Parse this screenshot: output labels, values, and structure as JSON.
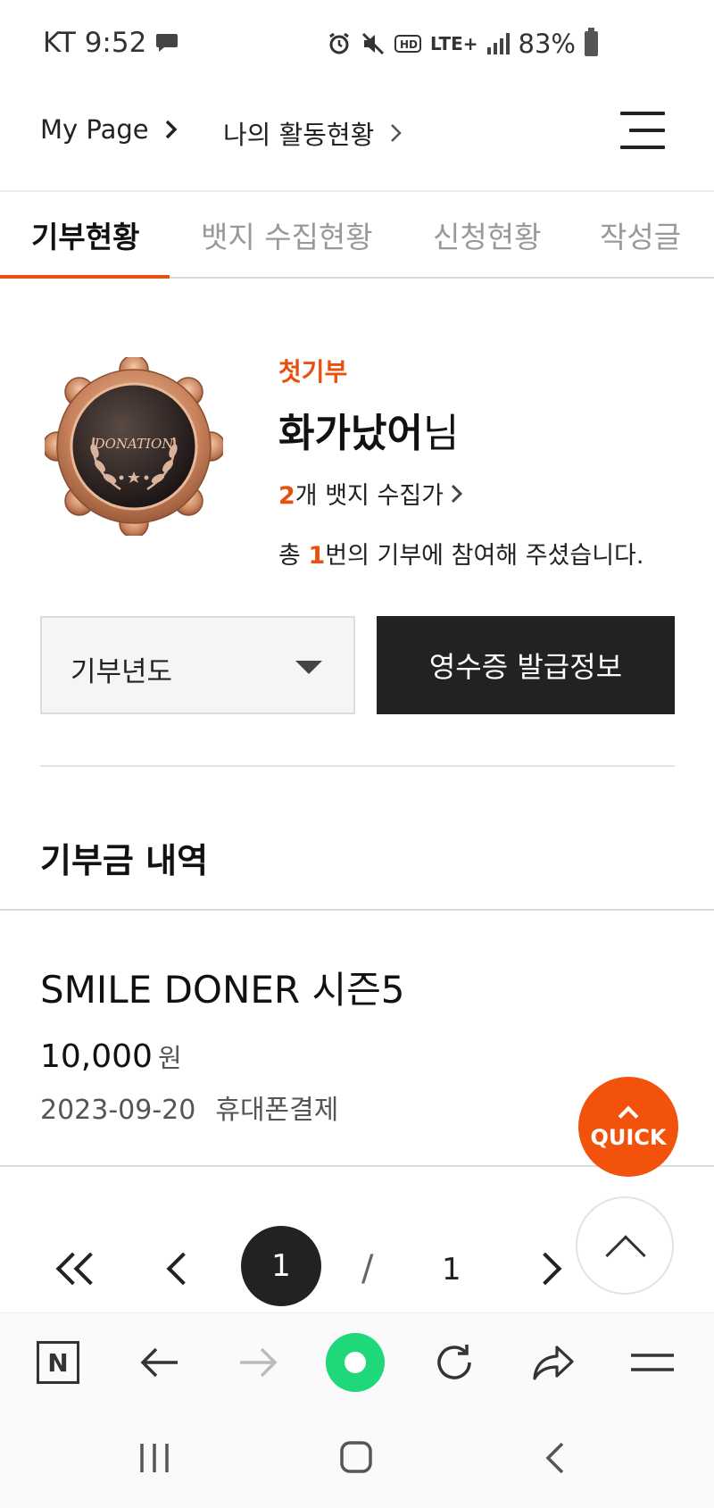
{
  "status_bar": {
    "carrier_time": "KT 9:52",
    "network": "LTE+",
    "battery": "83%"
  },
  "breadcrumb": {
    "item1": "My Page",
    "item2": "나의 활동현황"
  },
  "tabs": [
    {
      "label": "기부현황",
      "active": true
    },
    {
      "label": "뱃지 수집현황",
      "active": false
    },
    {
      "label": "신청현황",
      "active": false
    },
    {
      "label": "작성글",
      "active": false
    }
  ],
  "badge": {
    "text": "DONATION"
  },
  "profile": {
    "subtitle": "첫기부",
    "name": "화가났어",
    "name_suffix": "님",
    "badge_count": "2",
    "badge_text": "개 뱃지 수집가",
    "total_prefix": "총 ",
    "total_count": "1",
    "total_suffix": "번의 기부에 참여해 주셨습니다."
  },
  "controls": {
    "year_select": "기부년도",
    "receipt_button": "영수증 발급정보"
  },
  "section_title": "기부금 내역",
  "donation": {
    "title": "SMILE DONER 시즌5",
    "amount": "10,000",
    "unit": "원",
    "date": "2023-09-20",
    "method": "휴대폰결제"
  },
  "quick": {
    "label": "QUICK"
  },
  "pagination": {
    "current": "1",
    "separator": "/",
    "total": "1"
  },
  "colors": {
    "accent": "#e8500f",
    "quick": "#f2520c",
    "dark": "#222222",
    "naver_green": "#1fd879"
  }
}
